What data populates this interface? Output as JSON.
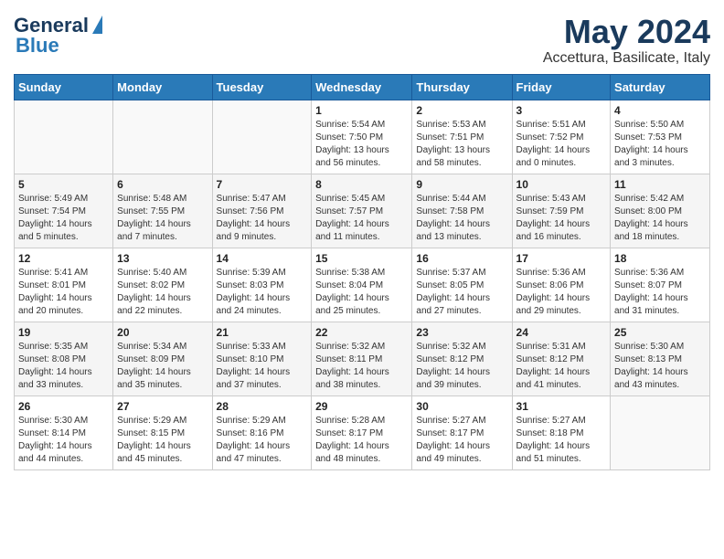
{
  "header": {
    "logo_general": "General",
    "logo_blue": "Blue",
    "month": "May 2024",
    "location": "Accettura, Basilicate, Italy"
  },
  "weekdays": [
    "Sunday",
    "Monday",
    "Tuesday",
    "Wednesday",
    "Thursday",
    "Friday",
    "Saturday"
  ],
  "weeks": [
    [
      {
        "day": "",
        "info": ""
      },
      {
        "day": "",
        "info": ""
      },
      {
        "day": "",
        "info": ""
      },
      {
        "day": "1",
        "info": "Sunrise: 5:54 AM\nSunset: 7:50 PM\nDaylight: 13 hours\nand 56 minutes."
      },
      {
        "day": "2",
        "info": "Sunrise: 5:53 AM\nSunset: 7:51 PM\nDaylight: 13 hours\nand 58 minutes."
      },
      {
        "day": "3",
        "info": "Sunrise: 5:51 AM\nSunset: 7:52 PM\nDaylight: 14 hours\nand 0 minutes."
      },
      {
        "day": "4",
        "info": "Sunrise: 5:50 AM\nSunset: 7:53 PM\nDaylight: 14 hours\nand 3 minutes."
      }
    ],
    [
      {
        "day": "5",
        "info": "Sunrise: 5:49 AM\nSunset: 7:54 PM\nDaylight: 14 hours\nand 5 minutes."
      },
      {
        "day": "6",
        "info": "Sunrise: 5:48 AM\nSunset: 7:55 PM\nDaylight: 14 hours\nand 7 minutes."
      },
      {
        "day": "7",
        "info": "Sunrise: 5:47 AM\nSunset: 7:56 PM\nDaylight: 14 hours\nand 9 minutes."
      },
      {
        "day": "8",
        "info": "Sunrise: 5:45 AM\nSunset: 7:57 PM\nDaylight: 14 hours\nand 11 minutes."
      },
      {
        "day": "9",
        "info": "Sunrise: 5:44 AM\nSunset: 7:58 PM\nDaylight: 14 hours\nand 13 minutes."
      },
      {
        "day": "10",
        "info": "Sunrise: 5:43 AM\nSunset: 7:59 PM\nDaylight: 14 hours\nand 16 minutes."
      },
      {
        "day": "11",
        "info": "Sunrise: 5:42 AM\nSunset: 8:00 PM\nDaylight: 14 hours\nand 18 minutes."
      }
    ],
    [
      {
        "day": "12",
        "info": "Sunrise: 5:41 AM\nSunset: 8:01 PM\nDaylight: 14 hours\nand 20 minutes."
      },
      {
        "day": "13",
        "info": "Sunrise: 5:40 AM\nSunset: 8:02 PM\nDaylight: 14 hours\nand 22 minutes."
      },
      {
        "day": "14",
        "info": "Sunrise: 5:39 AM\nSunset: 8:03 PM\nDaylight: 14 hours\nand 24 minutes."
      },
      {
        "day": "15",
        "info": "Sunrise: 5:38 AM\nSunset: 8:04 PM\nDaylight: 14 hours\nand 25 minutes."
      },
      {
        "day": "16",
        "info": "Sunrise: 5:37 AM\nSunset: 8:05 PM\nDaylight: 14 hours\nand 27 minutes."
      },
      {
        "day": "17",
        "info": "Sunrise: 5:36 AM\nSunset: 8:06 PM\nDaylight: 14 hours\nand 29 minutes."
      },
      {
        "day": "18",
        "info": "Sunrise: 5:36 AM\nSunset: 8:07 PM\nDaylight: 14 hours\nand 31 minutes."
      }
    ],
    [
      {
        "day": "19",
        "info": "Sunrise: 5:35 AM\nSunset: 8:08 PM\nDaylight: 14 hours\nand 33 minutes."
      },
      {
        "day": "20",
        "info": "Sunrise: 5:34 AM\nSunset: 8:09 PM\nDaylight: 14 hours\nand 35 minutes."
      },
      {
        "day": "21",
        "info": "Sunrise: 5:33 AM\nSunset: 8:10 PM\nDaylight: 14 hours\nand 37 minutes."
      },
      {
        "day": "22",
        "info": "Sunrise: 5:32 AM\nSunset: 8:11 PM\nDaylight: 14 hours\nand 38 minutes."
      },
      {
        "day": "23",
        "info": "Sunrise: 5:32 AM\nSunset: 8:12 PM\nDaylight: 14 hours\nand 39 minutes."
      },
      {
        "day": "24",
        "info": "Sunrise: 5:31 AM\nSunset: 8:12 PM\nDaylight: 14 hours\nand 41 minutes."
      },
      {
        "day": "25",
        "info": "Sunrise: 5:30 AM\nSunset: 8:13 PM\nDaylight: 14 hours\nand 43 minutes."
      }
    ],
    [
      {
        "day": "26",
        "info": "Sunrise: 5:30 AM\nSunset: 8:14 PM\nDaylight: 14 hours\nand 44 minutes."
      },
      {
        "day": "27",
        "info": "Sunrise: 5:29 AM\nSunset: 8:15 PM\nDaylight: 14 hours\nand 45 minutes."
      },
      {
        "day": "28",
        "info": "Sunrise: 5:29 AM\nSunset: 8:16 PM\nDaylight: 14 hours\nand 47 minutes."
      },
      {
        "day": "29",
        "info": "Sunrise: 5:28 AM\nSunset: 8:17 PM\nDaylight: 14 hours\nand 48 minutes."
      },
      {
        "day": "30",
        "info": "Sunrise: 5:27 AM\nSunset: 8:17 PM\nDaylight: 14 hours\nand 49 minutes."
      },
      {
        "day": "31",
        "info": "Sunrise: 5:27 AM\nSunset: 8:18 PM\nDaylight: 14 hours\nand 51 minutes."
      },
      {
        "day": "",
        "info": ""
      }
    ]
  ]
}
